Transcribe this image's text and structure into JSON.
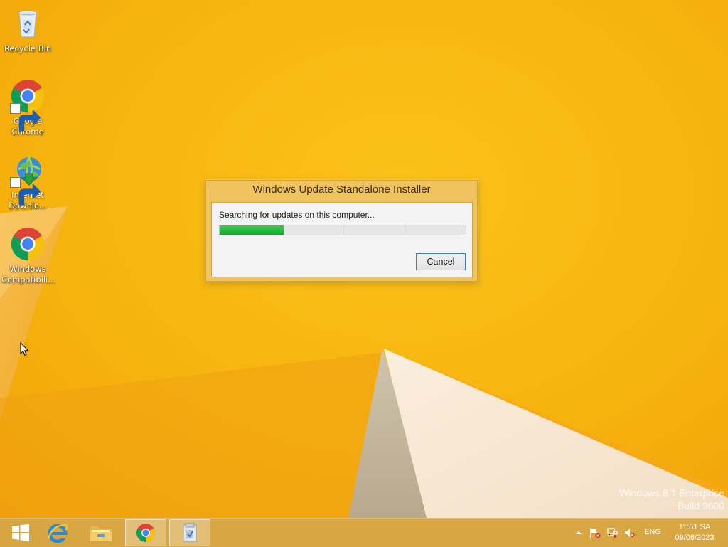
{
  "desktop": {
    "icons": [
      {
        "label": "Recycle Bin",
        "icon": "recycle-bin-icon"
      },
      {
        "label": "Google Chrome",
        "icon": "chrome-icon"
      },
      {
        "label": "Internet Downlo...",
        "icon": "internet-download-manager-icon"
      },
      {
        "label": "Windows Compatibili...",
        "icon": "chrome-icon"
      }
    ],
    "watermark": {
      "line1": "Windows 8.1 Enterprise",
      "line2": "Build 9600"
    }
  },
  "dialog": {
    "title": "Windows Update Standalone Installer",
    "status": "Searching for updates on this computer...",
    "progress_fraction": 0.26,
    "cancel_label": "Cancel"
  },
  "taskbar": {
    "apps": [
      {
        "name": "start",
        "icon": "windows-logo-icon"
      },
      {
        "name": "internet-explorer",
        "icon": "internet-explorer-icon"
      },
      {
        "name": "file-explorer",
        "icon": "folder-icon"
      },
      {
        "name": "google-chrome",
        "icon": "chrome-icon",
        "active": true
      },
      {
        "name": "update-installer",
        "icon": "installer-icon",
        "active": true
      }
    ],
    "tray": {
      "icons": [
        "chevron-up-icon",
        "action-center-flag-icon",
        "network-icon",
        "volume-muted-icon"
      ],
      "language": "ENG",
      "time": "11:51 SA",
      "date": "09/06/2023"
    }
  },
  "colors": {
    "wallpaper": "#f6b60e",
    "progress": "#22b23a",
    "dialog_frame": "#f1c35e",
    "taskbar": "#d6a546"
  }
}
